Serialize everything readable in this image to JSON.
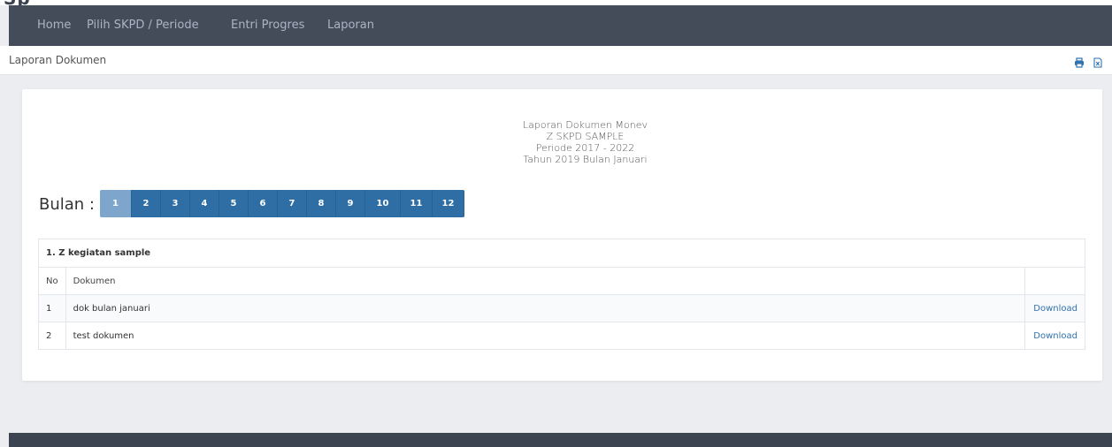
{
  "nav": {
    "items": [
      "Home",
      "Pilih SKPD / Periode",
      "Entri Progres",
      "Laporan"
    ]
  },
  "subheader": {
    "title": "Laporan Dokumen",
    "print_icon": "print-icon",
    "export_icon": "excel-file-icon"
  },
  "report": {
    "line1": "Laporan Dokumen Monev",
    "line2": "Z SKPD SAMPLE",
    "line3": "Periode 2017 - 2022",
    "line4": "Tahun 2019 Bulan Januari"
  },
  "bulan": {
    "label": "Bulan :",
    "months": [
      "1",
      "2",
      "3",
      "4",
      "5",
      "6",
      "7",
      "8",
      "9",
      "10",
      "11",
      "12"
    ],
    "active": "1"
  },
  "table": {
    "group_title": "1. Z kegiatan sample",
    "col_no": "No",
    "col_doc": "Dokumen",
    "rows": [
      {
        "no": "1",
        "doc": "dok bulan januari",
        "action": "Download"
      },
      {
        "no": "2",
        "doc": "test dokumen",
        "action": "Download"
      }
    ]
  },
  "colors": {
    "navbar": "#454c59",
    "pager": "#2f6ea5",
    "pager_active": "#7ea6cc",
    "link": "#2f72b0"
  }
}
